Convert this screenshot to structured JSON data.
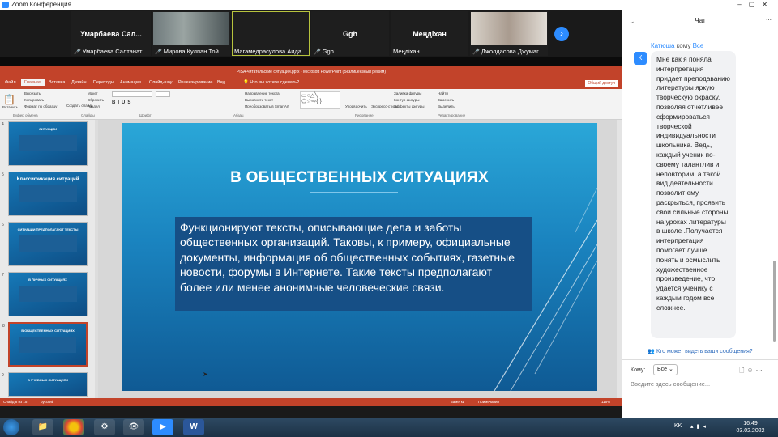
{
  "zoom": {
    "window_title": "Zoom Конференция",
    "participants": [
      {
        "big": "Умарбаева Сал...",
        "name": "Умарбаева Салтанат",
        "video": false,
        "muted": true
      },
      {
        "big": "",
        "name": "Мирова Кулпан Той...",
        "video": true,
        "muted": true
      },
      {
        "big": "",
        "name": "Магамедрасулова Аида",
        "video": true,
        "muted": false,
        "active": true
      },
      {
        "big": "Ggh",
        "name": "Ggh",
        "video": false,
        "muted": true
      },
      {
        "big": "Меңдіхан",
        "name": "Меңдіхан",
        "video": false,
        "muted": false
      },
      {
        "big": "",
        "name": "Джолдасова Джумаг...",
        "video": true,
        "muted": true
      }
    ]
  },
  "ppt": {
    "title": "PISA-читательские ситуации.pptx - Microsoft PowerPoint (Безлицензный режим)",
    "tabs": [
      "Файл",
      "Главная",
      "Вставка",
      "Дизайн",
      "Переходы",
      "Анимация",
      "Слайд-шоу",
      "Рецензирование",
      "Вид"
    ],
    "tell_me": "Что вы хотите сделать?",
    "share": "Общий доступ",
    "ribbon_groups": [
      "Буфер обмена",
      "Слайды",
      "Шрифт",
      "Абзац",
      "Рисование",
      "Редактирование"
    ],
    "ribbon_buttons": {
      "paste": "Вставить",
      "cut": "Вырезать",
      "copy": "Копировать",
      "format_painter": "Формат по образцу",
      "new_slide": "Создать слайд",
      "layout": "Макет",
      "reset": "Сбросить",
      "section": "Раздел",
      "text_direction": "Направление текста",
      "align_text": "Выровнять текст",
      "smartart": "Преобразовать в SmartArt",
      "arrange": "Упорядочить",
      "quick_styles": "Экспресс-стили",
      "shape_fill": "Заливка фигуры",
      "shape_outline": "Контур фигуры",
      "shape_effects": "Эффекты фигуры",
      "find": "Найти",
      "replace": "Заменить",
      "select": "Выделить"
    },
    "thumbnails": [
      {
        "num": "4",
        "title": "СИТУАЦИИ"
      },
      {
        "num": "5",
        "title": "Классификация ситуаций"
      },
      {
        "num": "6",
        "title": "СИТУАЦИИ ПРЕДПОЛАГАЮТ ТЕКСТЫ"
      },
      {
        "num": "7",
        "title": "В ЛИЧНЫХ СИТУАЦИЯХ"
      },
      {
        "num": "8",
        "title": "В ОБЩЕСТВЕННЫХ СИТУАЦИЯХ",
        "selected": true
      },
      {
        "num": "9",
        "title": "В УЧЕБНЫХ СИТУАЦИЯХ"
      }
    ],
    "slide": {
      "title": "В ОБЩЕСТВЕННЫХ СИТУАЦИЯХ",
      "body": "Функционируют тексты, описывающие дела и заботы общественных организаций. Таковы, к примеру, официальные документы, информация об общественных событиях, газетные новости, форумы в Интернете. Такие тексты предполагают более или менее анонимные человеческие связи."
    },
    "status": {
      "slide_of": "Слайд 8 из 15",
      "language": "русский",
      "notes": "Заметки",
      "comments": "Примечания",
      "zoom": "115%"
    }
  },
  "chat": {
    "header": "Чат",
    "from_name": "Катюша",
    "from_to": "кому",
    "from_target": "Все",
    "avatar_letter": "К",
    "message": "Мне как я поняла интерпретация придает преподаванию литературы яркую творческую окраску, позволяя отчетливее сформироваться творческой индивидуальности школьника. Ведь, каждый ученик  по-своему талантлив и неповторим, а такой вид деятельности позволит ему раскрыться, проявить свои сильные стороны на уроках литературы в школе .Получается интерпретация помогает лучше понять и осмыслить художественное произведение, что удается ученику с каждым годом все сложнее.",
    "who_can_see": "Кто может видеть ваши сообщения?",
    "to_label": "Кому:",
    "to_value": "Все",
    "input_placeholder": "Введите здесь сообщение..."
  },
  "taskbar": {
    "lang": "KK",
    "time": "16:49",
    "date": "03.02.2022"
  },
  "colors": {
    "zoom_blue": "#2d8cff",
    "ppt_red": "#c2432a"
  }
}
